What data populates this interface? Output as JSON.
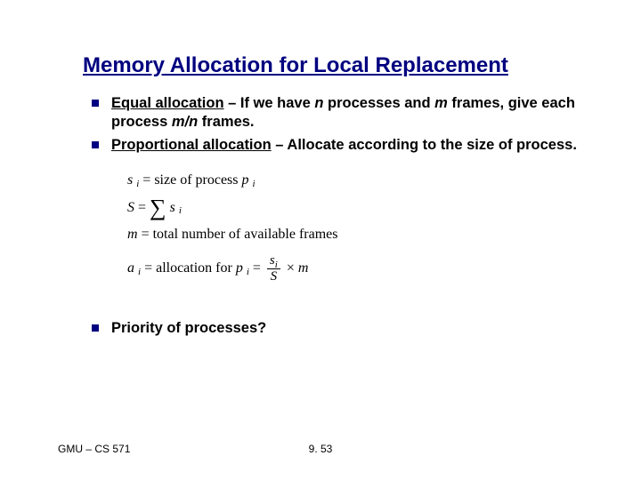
{
  "title": "Memory Allocation for Local Replacement",
  "bullets": {
    "b1_term": "Equal allocation",
    "b1_rest_a": " – If we have ",
    "b1_n": "n",
    "b1_rest_b": " processes and ",
    "b1_m": "m",
    "b1_rest_c": " frames, give each process  ",
    "b1_mn": "m/n",
    "b1_rest_d": "  frames.",
    "b2_term": "Proportional allocation",
    "b2_rest": " – Allocate according to the size of process.",
    "b3": "Priority of processes?"
  },
  "formulas": {
    "l1_a": "s",
    "l1_sub": "i",
    "l1_eq": " = size of process ",
    "l1_p": "p",
    "l1_psub": "i",
    "l2_a": "S",
    "l2_eq": " = ",
    "l2_sum": "∑",
    "l2_s": "s",
    "l2_sub": "i",
    "l3_a": "m",
    "l3_eq": " = total number of  available frames",
    "l4_a": "a",
    "l4_sub": "i",
    "l4_eq": " = allocation for ",
    "l4_p": "p",
    "l4_psub": "i",
    "l4_eq2": " = ",
    "l4_num_s": "s",
    "l4_num_sub": "i",
    "l4_den": "S",
    "l4_times": " × ",
    "l4_m": "m"
  },
  "footer": {
    "left": "GMU – CS 571",
    "center": "9. 53"
  }
}
